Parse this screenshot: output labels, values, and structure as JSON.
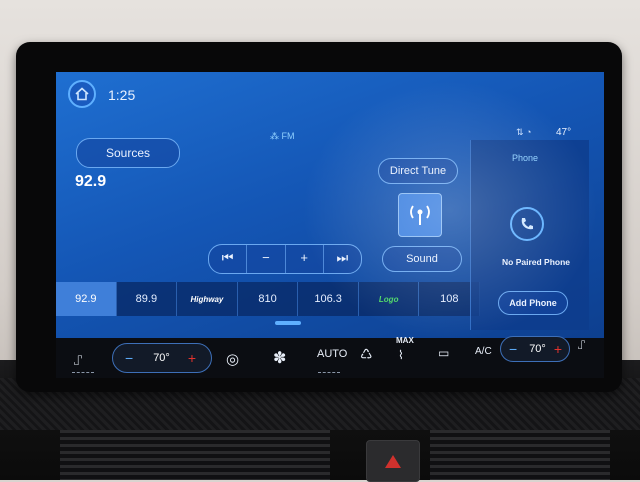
{
  "header": {
    "time": "1:25",
    "outside_temp": "47°"
  },
  "radio": {
    "sources_label": "Sources",
    "frequency": "92.9",
    "band": "FM",
    "direct_tune_label": "Direct Tune",
    "sound_label": "Sound",
    "transport": {
      "prev": "⏮",
      "minus": "−",
      "plus": "+",
      "next": "⏭"
    },
    "presets": [
      "92.9",
      "89.9",
      "Highway",
      "810",
      "106.3",
      "Logo",
      "108"
    ]
  },
  "phone": {
    "title": "Phone",
    "status": "No Paired Phone",
    "add_label": "Add Phone"
  },
  "climate": {
    "left_temp": "70°",
    "right_temp": "70°",
    "auto_label": "AUTO",
    "max_label": "MAX",
    "ac_label": "A/C"
  },
  "colors": {
    "screen_blue": "#1456b5",
    "accent": "#5fb0ff",
    "heat_red": "#e4332e"
  }
}
